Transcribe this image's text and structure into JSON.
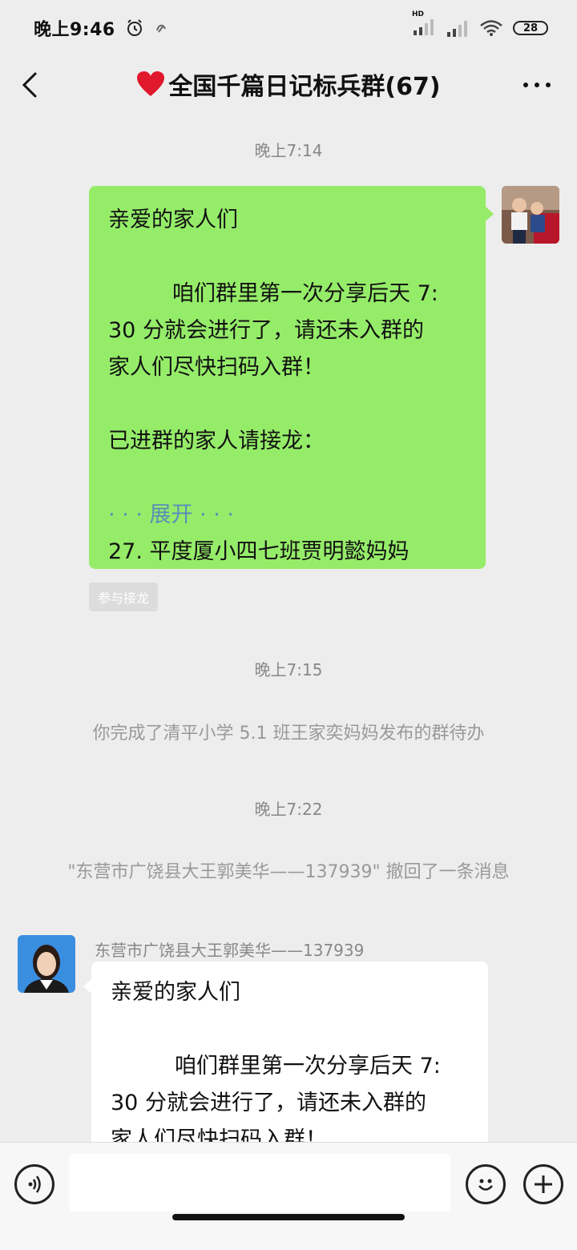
{
  "status_bar": {
    "time": "晚上9:46",
    "network_label": "HD",
    "battery": "28"
  },
  "header": {
    "title_icon": "heart-icon",
    "title": "全国千篇日记标兵群(67)"
  },
  "messages": {
    "ts1": "晚上7:14",
    "outgoing": {
      "greeting": "亲爱的家人们",
      "line1": "咱们群里第一次分享后天 7:",
      "line2": "30 分就会进行了，请还未入群的",
      "line3": "家人们尽快扫码入群！",
      "line4": "已进群的家人请接龙：",
      "expand": "· · · 展开 · · ·",
      "line5": "27. 平度厦小四七班贾明懿妈妈"
    },
    "join_button": "参与接龙",
    "ts2": "晚上7:15",
    "sys1": "你完成了清平小学 5.1 班王家奕妈妈发布的群待办",
    "ts3": "晚上7:22",
    "sys2": "\"东营市广饶县大王郭美华——137939\" 撤回了一条消息",
    "sender": "东营市广饶县大王郭美华——137939",
    "incoming": {
      "greeting": "亲爱的家人们",
      "line1": "咱们群里第一次分享后天 7:",
      "line2": "30 分就会进行了，请还未入群的",
      "line3": "家人们尽快扫码入群！"
    }
  },
  "colors": {
    "bubble_out": "#95ec69",
    "bubble_in": "#ffffff",
    "background": "#ededed"
  }
}
